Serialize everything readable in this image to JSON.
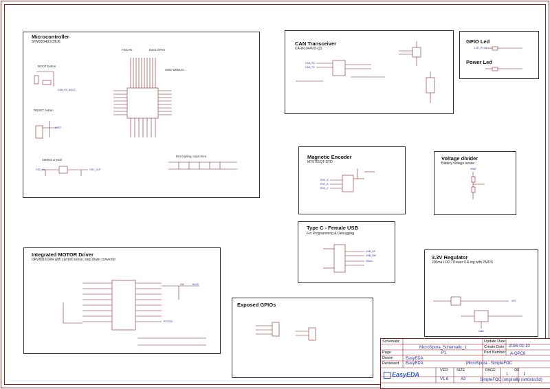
{
  "sections": {
    "mcu": {
      "title": "Microcontroller",
      "subtitle": "STM32G431CBU6",
      "boot": "BOOT button",
      "reset": "RESET button",
      "crystal": "16MHZ crystal",
      "fdcan": "FDCAN",
      "extra_gpio": "Extra GPIO",
      "swd": "SWD DEBUG",
      "decoupling": "Decoupling capacitors"
    },
    "can": {
      "title": "CAN Transceiver",
      "subtitle": "CA-IF1044VD-Q1"
    },
    "gpio_led": {
      "title": "GPIO Led"
    },
    "power_led": {
      "title": "Power Led"
    },
    "encoder": {
      "title": "Magnetic Encoder",
      "subtitle": "MT6701QT-STD"
    },
    "vdiv": {
      "title": "Voltage divider",
      "subtitle": "Battery voltage sense"
    },
    "usb": {
      "title": "Type C - Female USB",
      "subtitle": "For Programming & Debugging"
    },
    "motor": {
      "title": "Integrated MOTOR Driver",
      "subtitle": "DRV8316CRR with current sense, step down convertor"
    },
    "regulator": {
      "title": "3.3V Regulator",
      "subtitle": "200ma LDO / Power OR-ing with PMOS"
    },
    "gpios": {
      "title": "Exposed GPIOs"
    }
  },
  "titleblock": {
    "schematic_label": "Schematic",
    "schematic_value": "MicroSpora_Schematic_1",
    "page_label": "Page",
    "page_value": "P1",
    "drawn_label": "Drawn",
    "drawn_value": "EasyEDA",
    "reviewed_label": "Reviewed",
    "reviewed_value": "EasyEDA",
    "update_label": "Update Date",
    "update_value": "2026-02-10",
    "create_label": "Create Date",
    "part_label": "Part Number",
    "part_value": "A-OPC8",
    "project": "MicroSpora - SimpleFOC",
    "logo": "EasyEDA",
    "ver_label": "VER",
    "ver_value": "V1.6",
    "size_label": "SIZE",
    "size_value": "A3",
    "pg_label": "PAGE",
    "of_label": "OF",
    "pg_value": "1",
    "of_value": "1",
    "credit": "SimpleFOC (originally rambros3d)"
  },
  "nets": {
    "led_pc13": "LED_PC13",
    "can_rx": "CAN_RX",
    "can_tx": "CAN_TX",
    "can_rx_boot": "CAN_RX_BOOT",
    "gnd": "GND",
    "vcc": "3V3",
    "vbat": "VBAT",
    "nrst": "NRST",
    "osc_in": "OSC_IN",
    "osc_out": "OSC_OUT",
    "enc_a": "ENC_A",
    "enc_b": "ENC_B",
    "enc_z": "ENC_Z",
    "usb_dp": "USB_DP",
    "usb_dm": "USB_DM",
    "vbus": "VBUS",
    "pgood": "PGOOD",
    "sw": "SW",
    "buck": "BUCK"
  }
}
